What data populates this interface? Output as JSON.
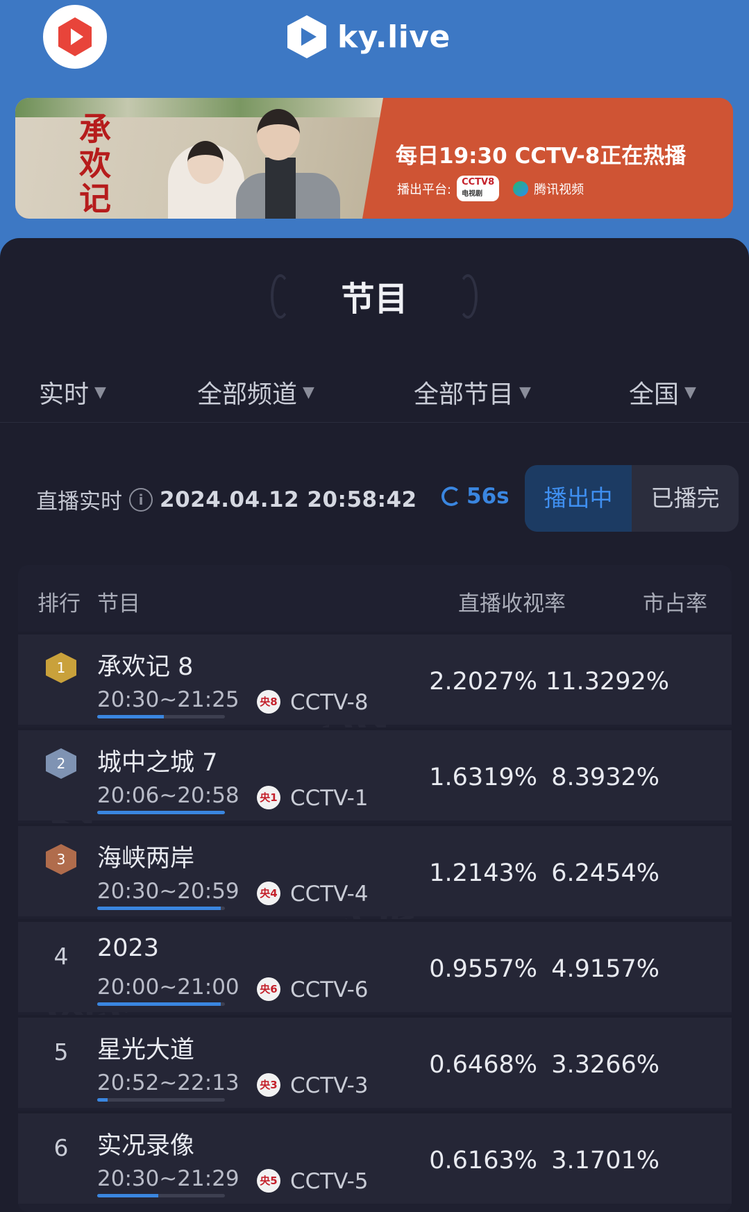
{
  "header": {
    "brand": "ky.live"
  },
  "banner": {
    "title": "承欢记",
    "schedule": "每日19:30  CCTV-8正在热播",
    "platform_label": "播出平台:",
    "cctv_logo": "CCTV8",
    "cctv_sub": "电视剧",
    "tencent": "腾讯视频"
  },
  "section": {
    "title": "节目"
  },
  "filters": [
    {
      "label": "实时"
    },
    {
      "label": "全部频道"
    },
    {
      "label": "全部节目"
    },
    {
      "label": "全国"
    }
  ],
  "live": {
    "label": "直播实时",
    "timestamp": "2024.04.12 20:58:42",
    "refresh": "56s",
    "seg_live": "播出中",
    "seg_done": "已播完"
  },
  "table": {
    "headers": {
      "rank": "排行",
      "program": "节目",
      "rating": "直播收视率",
      "share": "市占率"
    },
    "rows": [
      {
        "rank": "1",
        "name": "承欢记 8",
        "time": "20:30~21:25",
        "badge": "央8",
        "channel": "CCTV-8",
        "rating": "2.2027%",
        "share": "11.3292%",
        "progress": 0.52
      },
      {
        "rank": "2",
        "name": "城中之城 7",
        "time": "20:06~20:58",
        "badge": "央1",
        "channel": "CCTV-1",
        "rating": "1.6319%",
        "share": "8.3932%",
        "progress": 1.0
      },
      {
        "rank": "3",
        "name": "海峡两岸",
        "time": "20:30~20:59",
        "badge": "央4",
        "channel": "CCTV-4",
        "rating": "1.2143%",
        "share": "6.2454%",
        "progress": 0.97
      },
      {
        "rank": "4",
        "name": "2023",
        "time": "20:00~21:00",
        "badge": "央6",
        "channel": "CCTV-6",
        "rating": "0.9557%",
        "share": "4.9157%",
        "progress": 0.97
      },
      {
        "rank": "5",
        "name": "星光大道",
        "time": "20:52~22:13",
        "badge": "央3",
        "channel": "CCTV-3",
        "rating": "0.6468%",
        "share": "3.3266%",
        "progress": 0.08
      },
      {
        "rank": "6",
        "name": "实况录像",
        "time": "20:30~21:29",
        "badge": "央5",
        "channel": "CCTV-5",
        "rating": "0.6163%",
        "share": "3.1701%",
        "progress": 0.48
      }
    ]
  },
  "colors": {
    "accent": "#3a86e0",
    "header": "#3d78c4",
    "panel": "#1d1e2d",
    "gold": "#c9a13b",
    "silver": "#7f93b3",
    "bronze": "#b06c4c"
  }
}
